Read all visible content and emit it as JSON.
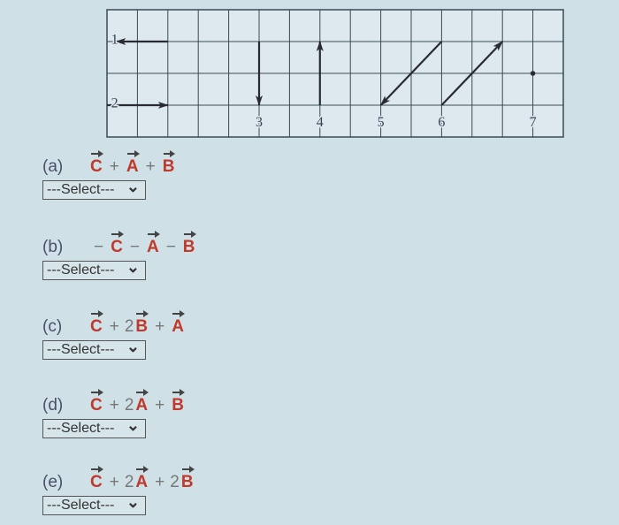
{
  "diagram": {
    "grid": {
      "columns": 15,
      "rows": 4,
      "line_color": "#3a4a55",
      "bg": "#dde9ee"
    },
    "labels": [
      {
        "text": "1",
        "col": 0.25,
        "row": 0.9
      },
      {
        "text": "2",
        "col": 0.25,
        "row": 2.9
      },
      {
        "text": "3",
        "col": 5,
        "row": 3.5
      },
      {
        "text": "4",
        "col": 7,
        "row": 3.5
      },
      {
        "text": "5",
        "col": 9,
        "row": 3.5
      },
      {
        "text": "6",
        "col": 11,
        "row": 3.5
      },
      {
        "text": "7",
        "col": 14,
        "row": 3.5
      }
    ],
    "vectors": [
      {
        "id": "1",
        "from": [
          2,
          1
        ],
        "to": [
          0.3,
          1
        ]
      },
      {
        "id": "2",
        "from": [
          0,
          3
        ],
        "to": [
          2,
          3
        ]
      },
      {
        "id": "3",
        "from": [
          5,
          1
        ],
        "to": [
          5,
          3
        ]
      },
      {
        "id": "4",
        "from": [
          7,
          3
        ],
        "to": [
          7,
          1
        ]
      },
      {
        "id": "5",
        "from": [
          11,
          1
        ],
        "to": [
          9,
          3
        ]
      },
      {
        "id": "6",
        "from": [
          11,
          3
        ],
        "to": [
          13,
          1
        ]
      }
    ],
    "points": [
      {
        "id": "7",
        "at": [
          14,
          2
        ]
      }
    ]
  },
  "questions": [
    {
      "label": "(a)",
      "terms": [
        {
          "sign": "",
          "coef": "",
          "v": "C"
        },
        {
          "sign": "+",
          "coef": "",
          "v": "A"
        },
        {
          "sign": "+",
          "coef": "",
          "v": "B"
        }
      ],
      "select": "---Select---"
    },
    {
      "label": "(b)",
      "terms": [
        {
          "sign": "−",
          "coef": "",
          "v": "C"
        },
        {
          "sign": "−",
          "coef": "",
          "v": "A"
        },
        {
          "sign": "−",
          "coef": "",
          "v": "B"
        }
      ],
      "select": "---Select---"
    },
    {
      "label": "(c)",
      "terms": [
        {
          "sign": "",
          "coef": "",
          "v": "C"
        },
        {
          "sign": "+",
          "coef": "2",
          "v": "B"
        },
        {
          "sign": "+",
          "coef": "",
          "v": "A"
        }
      ],
      "select": "---Select---"
    },
    {
      "label": "(d)",
      "terms": [
        {
          "sign": "",
          "coef": "",
          "v": "C"
        },
        {
          "sign": "+",
          "coef": "2",
          "v": "A"
        },
        {
          "sign": "+",
          "coef": "",
          "v": "B"
        }
      ],
      "select": "---Select---"
    },
    {
      "label": "(e)",
      "terms": [
        {
          "sign": "",
          "coef": "",
          "v": "C"
        },
        {
          "sign": "+",
          "coef": "2",
          "v": "A"
        },
        {
          "sign": "+",
          "coef": "2",
          "v": "B"
        }
      ],
      "select": "---Select---"
    }
  ]
}
